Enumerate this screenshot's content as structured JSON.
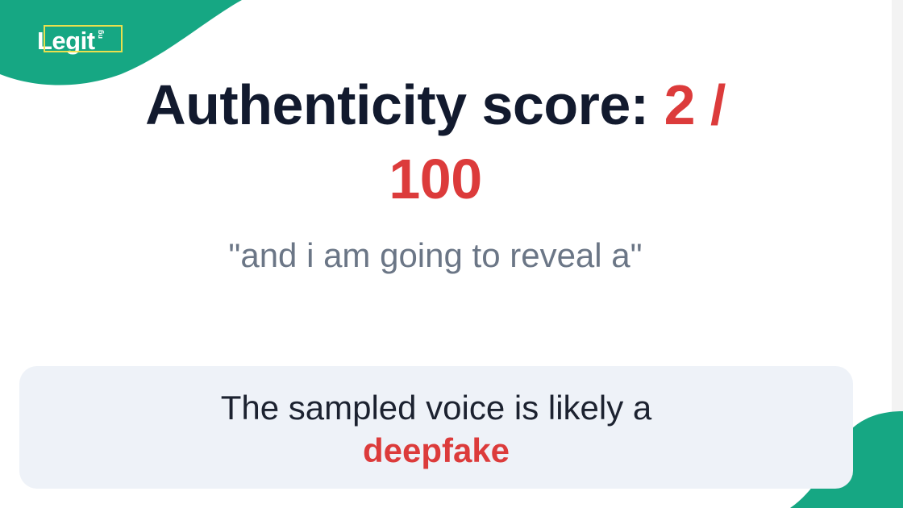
{
  "brand": {
    "logo_text": "Legit",
    "logo_suffix": "ng",
    "accent_color": "#16a783"
  },
  "score": {
    "label": "Authenticity score:",
    "value": "2 /",
    "max": "100",
    "value_color": "#dc3b3b"
  },
  "transcript": {
    "quote": "\"and i am going to reveal a\""
  },
  "verdict": {
    "text": "The sampled voice is likely a",
    "result": "deepfake"
  }
}
